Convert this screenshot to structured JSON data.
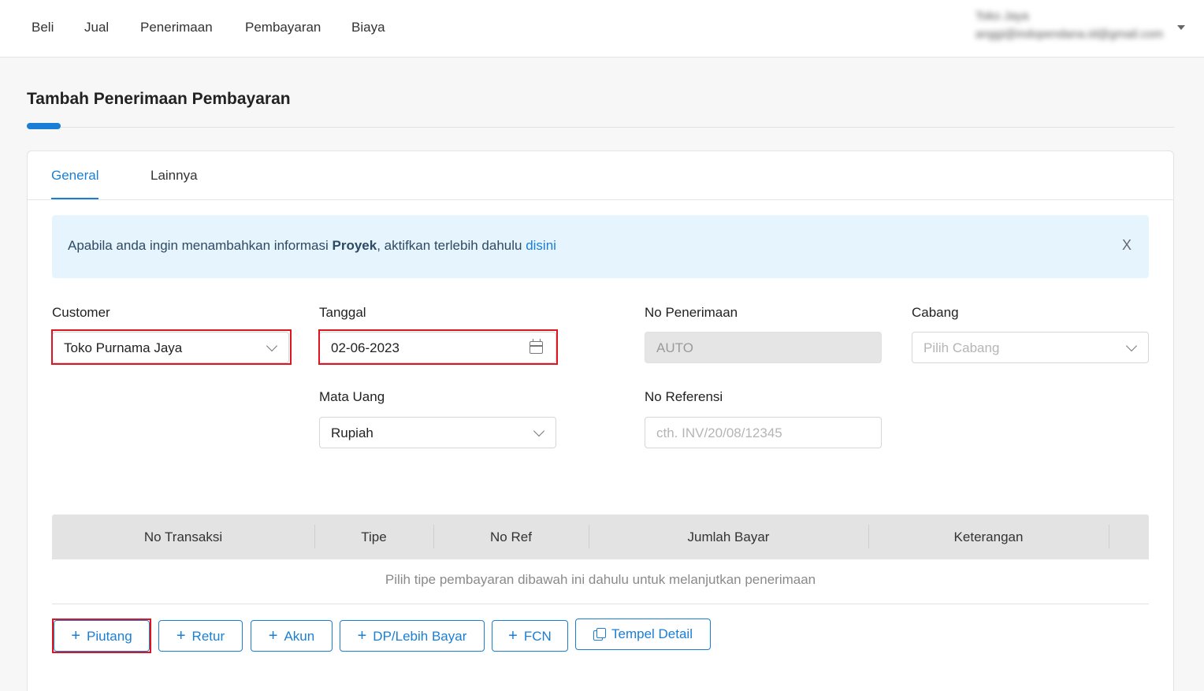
{
  "nav": {
    "items": [
      "Beli",
      "Jual",
      "Penerimaan",
      "Pembayaran",
      "Biaya"
    ],
    "user": {
      "name": "Toko Jaya",
      "email": "anggi@indopendana.id@gmail.com"
    }
  },
  "page": {
    "title": "Tambah Penerimaan Pembayaran"
  },
  "tabs": [
    "General",
    "Lainnya"
  ],
  "alert": {
    "text_before": "Apabila anda ingin menambahkan informasi ",
    "text_bold": "Proyek",
    "text_after": ", aktifkan terlebih dahulu ",
    "link": "disini",
    "close": "X"
  },
  "form": {
    "customer": {
      "label": "Customer",
      "value": "Toko Purnama Jaya"
    },
    "tanggal": {
      "label": "Tanggal",
      "value": "02-06-2023"
    },
    "no_penerimaan": {
      "label": "No Penerimaan",
      "value": "AUTO"
    },
    "cabang": {
      "label": "Cabang",
      "placeholder": "Pilih Cabang"
    },
    "mata_uang": {
      "label": "Mata Uang",
      "value": "Rupiah"
    },
    "no_referensi": {
      "label": "No Referensi",
      "placeholder": "cth. INV/20/08/12345"
    }
  },
  "table": {
    "columns": [
      "No Transaksi",
      "Tipe",
      "No Ref",
      "Jumlah Bayar",
      "Keterangan"
    ],
    "empty_message": "Pilih tipe pembayaran dibawah ini dahulu untuk melanjutkan penerimaan"
  },
  "actions": {
    "piutang": "Piutang",
    "retur": "Retur",
    "akun": "Akun",
    "dp": "DP/Lebih Bayar",
    "fcn": "FCN",
    "tempel": "Tempel Detail"
  },
  "colors": {
    "accent": "#1a7fd4",
    "highlight": "#e0141e",
    "alert_bg": "#e6f5fd"
  }
}
